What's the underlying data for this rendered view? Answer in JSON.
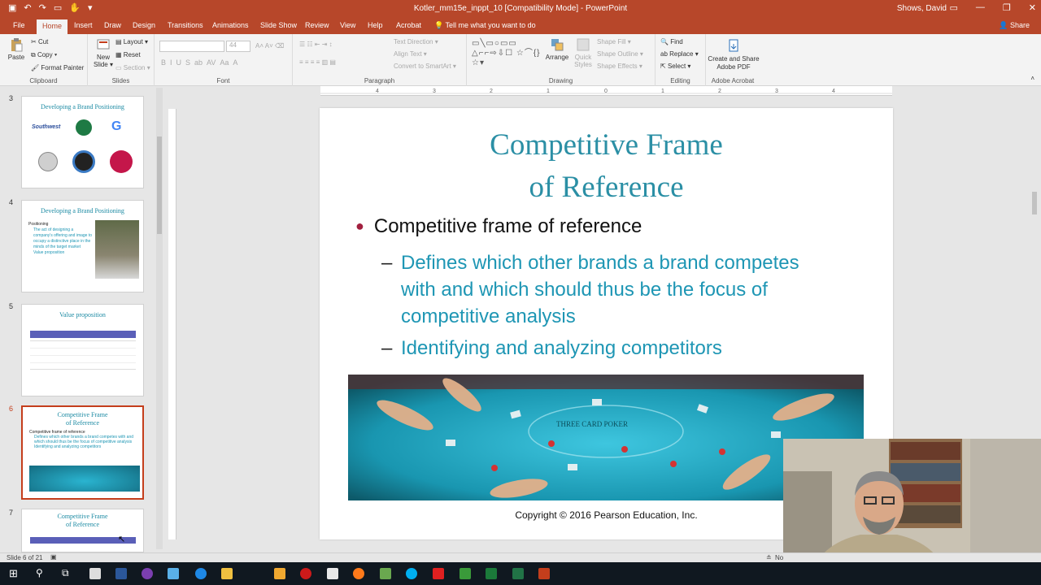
{
  "window": {
    "title": "Kotler_mm15e_inppt_10 [Compatibility Mode] - PowerPoint",
    "user": "Shows, David"
  },
  "tabs": [
    {
      "label": "File"
    },
    {
      "label": "Home"
    },
    {
      "label": "Insert"
    },
    {
      "label": "Draw"
    },
    {
      "label": "Design"
    },
    {
      "label": "Transitions"
    },
    {
      "label": "Animations"
    },
    {
      "label": "Slide Show"
    },
    {
      "label": "Review"
    },
    {
      "label": "View"
    },
    {
      "label": "Help"
    },
    {
      "label": "Acrobat"
    }
  ],
  "tell_me": "Tell me what you want to do",
  "share": "Share",
  "ribbon": {
    "clipboard": {
      "paste": "Paste",
      "cut": "Cut",
      "copy": "Copy",
      "format_painter": "Format Painter",
      "label": "Clipboard"
    },
    "slides": {
      "new_slide": "New Slide",
      "layout": "Layout",
      "reset": "Reset",
      "section": "Section",
      "label": "Slides"
    },
    "font": {
      "size": "44",
      "label": "Font"
    },
    "paragraph": {
      "text_direction": "Text Direction",
      "align_text": "Align Text",
      "convert_smartart": "Convert to SmartArt",
      "label": "Paragraph"
    },
    "drawing": {
      "arrange": "Arrange",
      "quick_styles": "Quick Styles",
      "shape_fill": "Shape Fill",
      "shape_outline": "Shape Outline",
      "shape_effects": "Shape Effects",
      "label": "Drawing"
    },
    "editing": {
      "find": "Find",
      "replace": "Replace",
      "select": "Select",
      "label": "Editing"
    },
    "acrobat": {
      "create_share": "Create and Share Adobe PDF",
      "label": "Adobe Acrobat"
    }
  },
  "thumbnails": [
    {
      "num": "3",
      "title": "Developing a Brand Positioning"
    },
    {
      "num": "4",
      "title": "Developing a Brand Positioning",
      "b1": "Positioning",
      "b2": "The act of designing a company's offering and image to occupy a distinctive place in the minds of the target market",
      "b3": "Value proposition"
    },
    {
      "num": "5",
      "title": "Value proposition"
    },
    {
      "num": "6",
      "title": "Competitive Frame of Reference",
      "b1": "Competitive frame of reference",
      "b2": "Defines which other brands a brand competes with and which should thus be the focus of competitive analysis",
      "b3": "Identifying and analyzing competitors"
    },
    {
      "num": "7",
      "title": "Competitive Frame of Reference"
    }
  ],
  "slide": {
    "title_line1": "Competitive Frame",
    "title_line2": "of Reference",
    "bullet": "Competitive frame of reference",
    "sub1_line1": "Defines which other brands a brand competes",
    "sub1_line2": "with and which should thus be the focus of",
    "sub1_line3": "competitive analysis",
    "sub2": "Identifying and analyzing competitors",
    "photo_text": "THREE CARD POKER",
    "copyright": "Copyright © 2016 Pearson Education, Inc."
  },
  "status": {
    "slide_of": "Slide 6 of 21",
    "notes_partial": "No"
  },
  "colors": {
    "accent": "#b7472a",
    "title": "#2b8fa5",
    "sub_text": "#1e96b4",
    "bullet": "#a2203f"
  }
}
